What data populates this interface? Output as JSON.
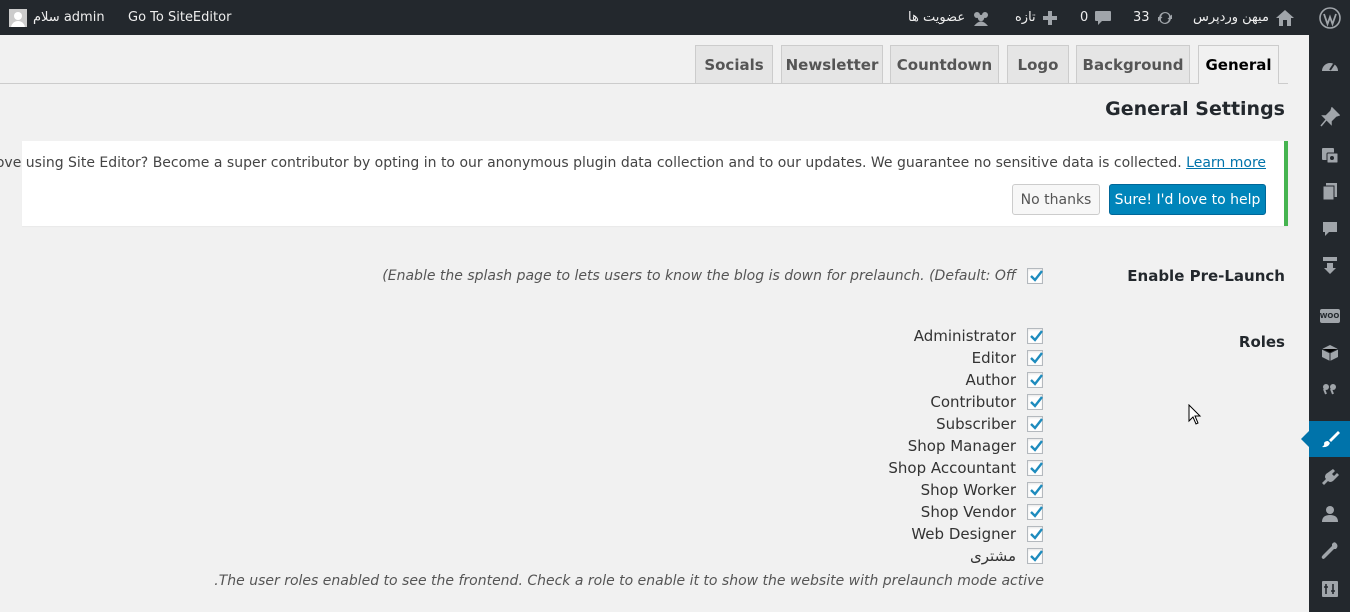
{
  "admin_bar": {
    "greeting": "سلام admin",
    "site_editor_link": "Go To SiteEditor",
    "site_name": "میهن وردپرس",
    "updates_count": "33",
    "comments_count": "0",
    "new_label": "تازه",
    "membership_label": "عضویت ها"
  },
  "tabs": [
    "Socials",
    "Newsletter",
    "Countdown",
    "Logo",
    "Background",
    "General"
  ],
  "active_tab": "General",
  "page_title": "General Settings",
  "notice": {
    "text": "Love using Site Editor? Become a super contributor by opting in to our anonymous plugin data collection and to our updates. We guarantee no sensitive data is collected.",
    "link_text": "Learn more",
    "no_thanks_label": "No thanks",
    "sure_label": "Sure! I'd love to help",
    "accent_color": "#46b450"
  },
  "prelaunch": {
    "label": "Enable Pre-Launch",
    "checked": true,
    "description": "(Enable the splash page to lets users to know the blog is down for prelaunch. (Default: Off"
  },
  "roles": {
    "label": "Roles",
    "items": [
      {
        "name": "Administrator",
        "checked": true
      },
      {
        "name": "Editor",
        "checked": true
      },
      {
        "name": "Author",
        "checked": true
      },
      {
        "name": "Contributor",
        "checked": true
      },
      {
        "name": "Subscriber",
        "checked": true
      },
      {
        "name": "Shop Manager",
        "checked": true
      },
      {
        "name": "Shop Accountant",
        "checked": true
      },
      {
        "name": "Shop Worker",
        "checked": true
      },
      {
        "name": "Shop Vendor",
        "checked": true
      },
      {
        "name": "Web Designer",
        "checked": true
      },
      {
        "name": "مشتری",
        "checked": true
      }
    ],
    "description": ".The user roles enabled to see the frontend. Check a role to enable it to show the website with prelaunch mode active"
  },
  "colors": {
    "admin_bar_bg": "#23282d",
    "primary_button": "#0085ba",
    "active_menu": "#0073aa",
    "checkmark": "#1e8cbe"
  },
  "sidebar_menu_icons": [
    "dashboard-icon",
    "pin-icon",
    "media-icon",
    "pages-icon",
    "comments-icon",
    "feedback-icon",
    "woocommerce-icon",
    "products-icon",
    "quotes-icon",
    "appearance-icon",
    "plugins-icon",
    "users-icon",
    "tools-icon",
    "settings-icon"
  ]
}
